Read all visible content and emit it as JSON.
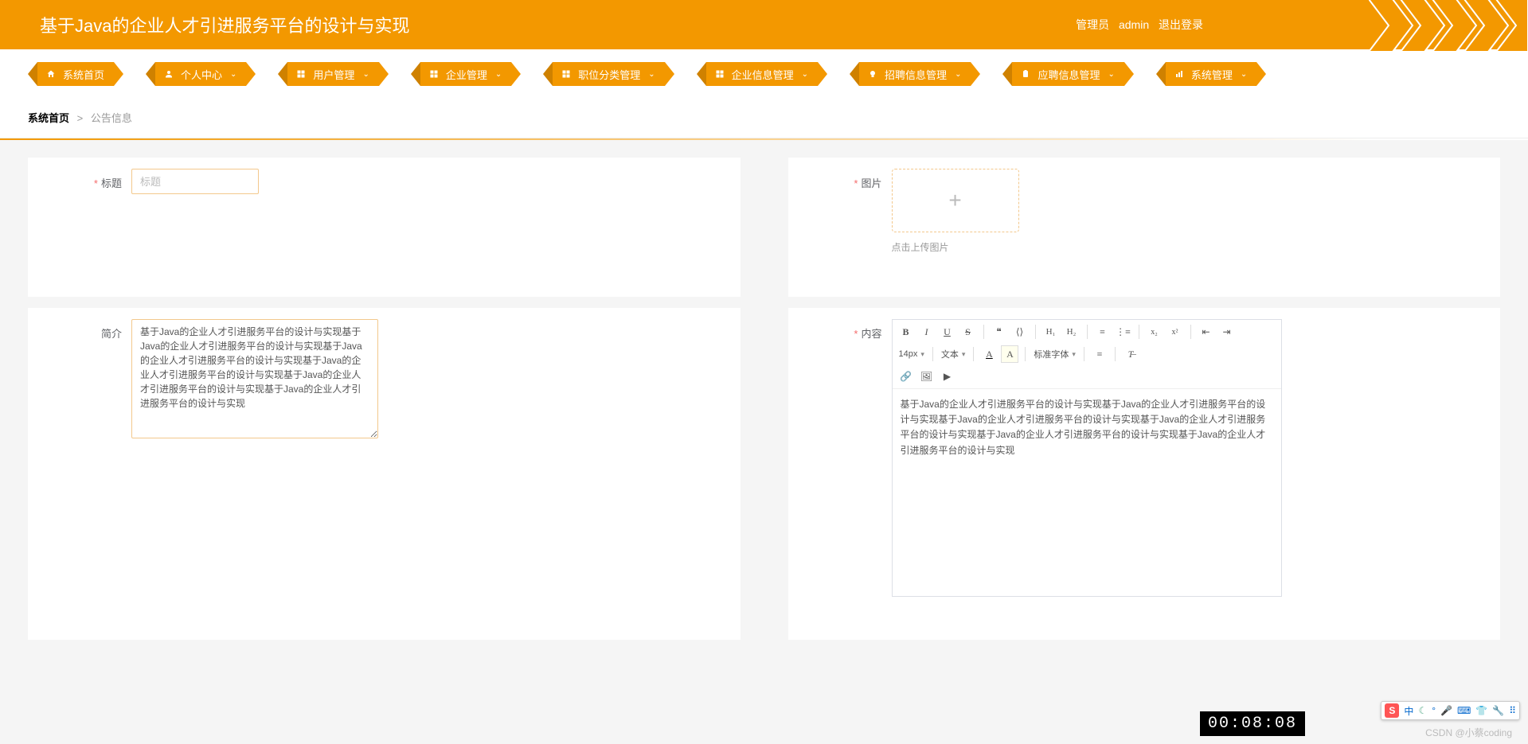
{
  "header": {
    "title": "基于Java的企业人才引进服务平台的设计与实现",
    "role": "管理员",
    "user": "admin",
    "logout": "退出登录"
  },
  "nav": [
    {
      "icon": "home",
      "label": "系统首页",
      "caret": false
    },
    {
      "icon": "user",
      "label": "个人中心",
      "caret": true
    },
    {
      "icon": "grid",
      "label": "用户管理",
      "caret": true
    },
    {
      "icon": "grid",
      "label": "企业管理",
      "caret": true
    },
    {
      "icon": "grid",
      "label": "职位分类管理",
      "caret": true
    },
    {
      "icon": "grid",
      "label": "企业信息管理",
      "caret": true
    },
    {
      "icon": "bulb",
      "label": "招聘信息管理",
      "caret": true
    },
    {
      "icon": "clip",
      "label": "应聘信息管理",
      "caret": true
    },
    {
      "icon": "chart",
      "label": "系统管理",
      "caret": true
    }
  ],
  "breadcrumb": {
    "home": "系统首页",
    "sep": ">",
    "current": "公告信息"
  },
  "form": {
    "title_label": "标题",
    "title_placeholder": "标题",
    "image_label": "图片",
    "upload_tip": "点击上传图片",
    "intro_label": "简介",
    "intro_value": "基于Java的企业人才引进服务平台的设计与实现基于Java的企业人才引进服务平台的设计与实现基于Java的企业人才引进服务平台的设计与实现基于Java的企业人才引进服务平台的设计与实现基于Java的企业人才引进服务平台的设计与实现基于Java的企业人才引进服务平台的设计与实现",
    "content_label": "内容",
    "content_value": "基于Java的企业人才引进服务平台的设计与实现基于Java的企业人才引进服务平台的设计与实现基于Java的企业人才引进服务平台的设计与实现基于Java的企业人才引进服务平台的设计与实现基于Java的企业人才引进服务平台的设计与实现基于Java的企业人才引进服务平台的设计与实现"
  },
  "editor": {
    "fontsize": "14px",
    "style": "文本",
    "font": "标准字体"
  },
  "overlay": {
    "timer": "00:08:08",
    "watermark": "CSDN @小蔡coding",
    "ime_lang": "中"
  }
}
